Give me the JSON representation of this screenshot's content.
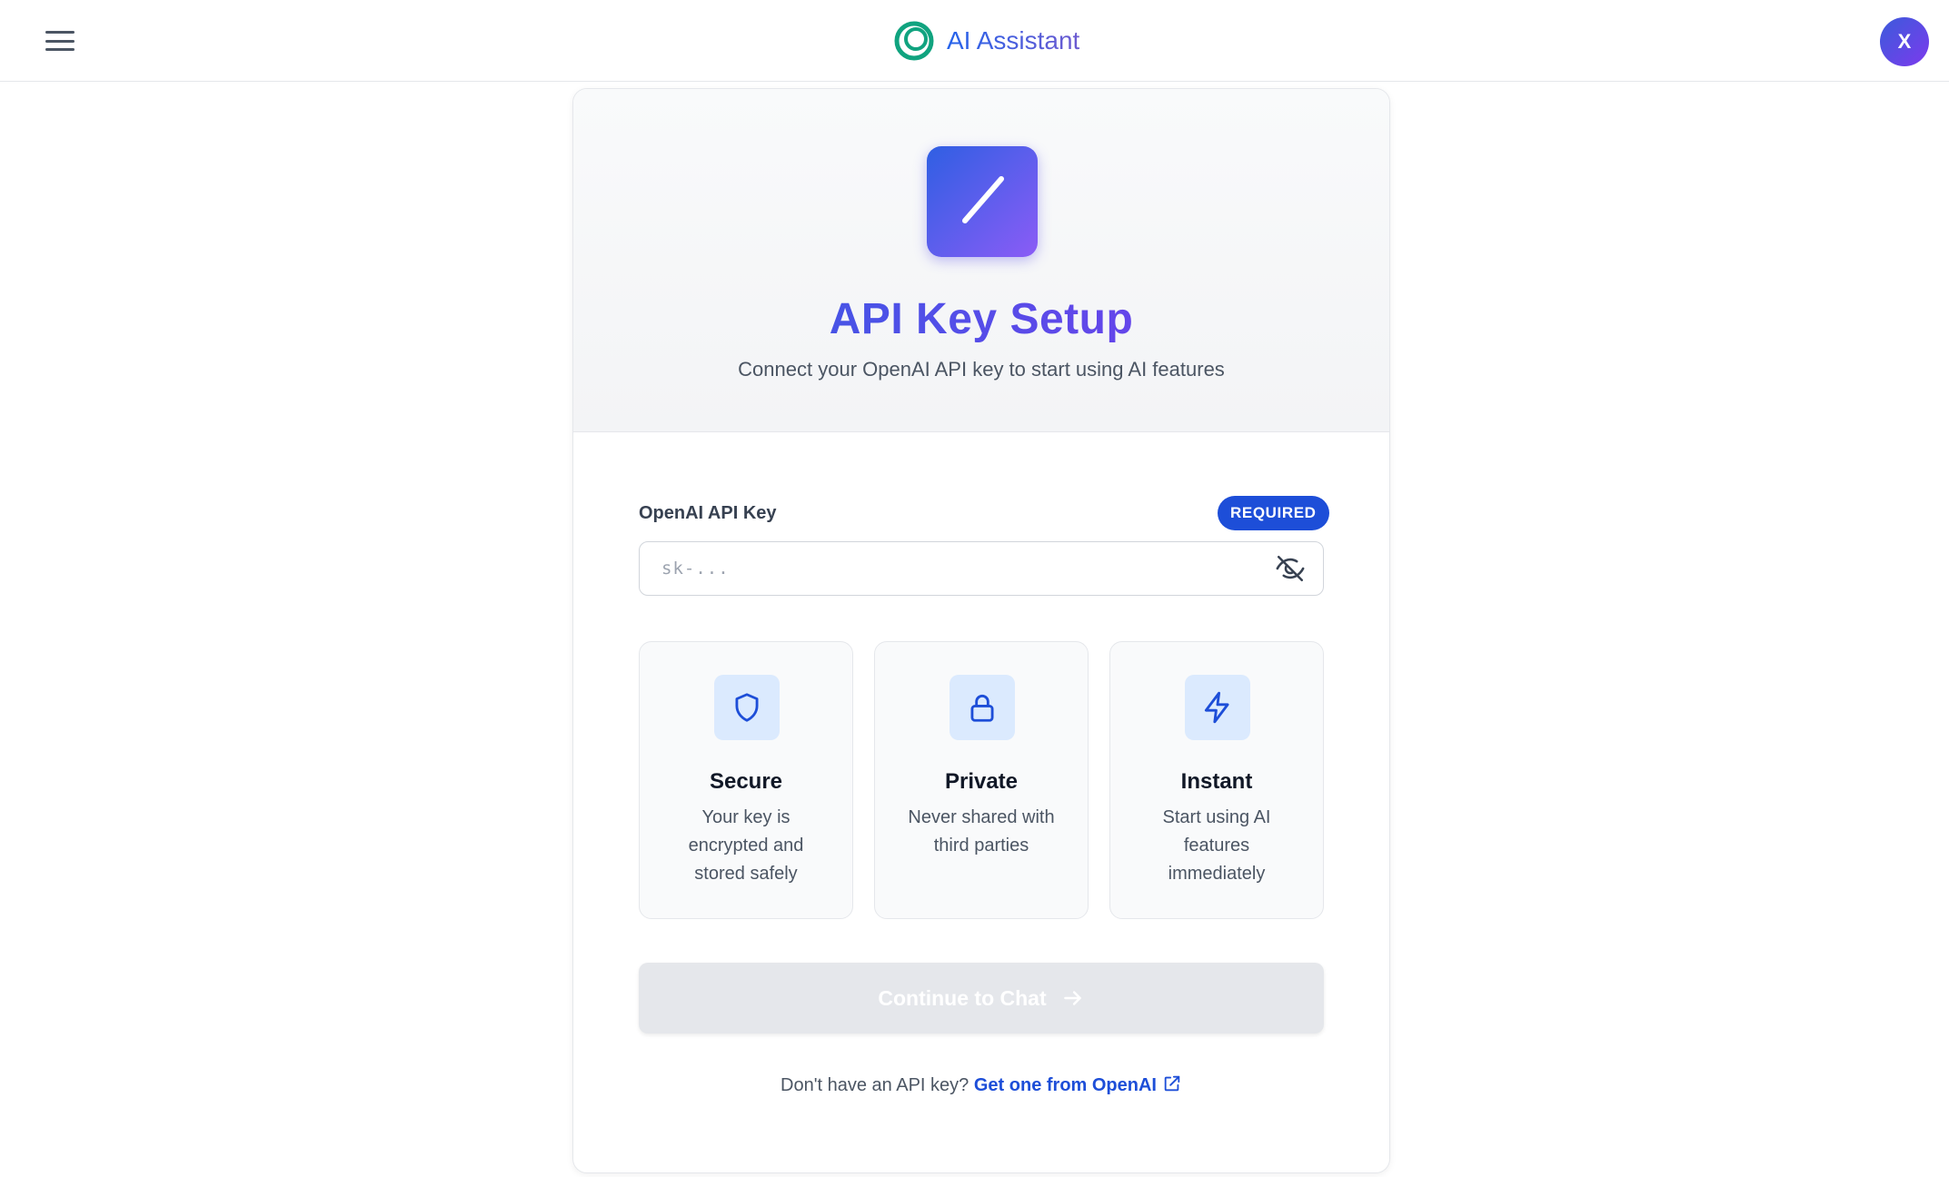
{
  "header": {
    "brand_title": "AI Assistant",
    "avatar_initial": "X"
  },
  "setup": {
    "title": "API Key Setup",
    "subtitle": "Connect your OpenAI API key to start using AI features",
    "field_label": "OpenAI API Key",
    "required_badge": "REQUIRED",
    "input_value": "",
    "input_placeholder": "sk-...",
    "features": [
      {
        "title": "Secure",
        "description": "Your key is encrypted and stored safely",
        "icon": "shield-icon"
      },
      {
        "title": "Private",
        "description": "Never shared with third parties",
        "icon": "lock-icon"
      },
      {
        "title": "Instant",
        "description": "Start using AI features immediately",
        "icon": "lightning-icon"
      }
    ],
    "continue_label": "Continue to Chat",
    "footer_prefix": "Don't have an API key?",
    "footer_link": "Get one from OpenAI"
  },
  "colors": {
    "accent": "#1d4ed8",
    "gradient_start": "#2f5fe3",
    "gradient_end": "#8b5cf6",
    "button_disabled": "#e5e7eb"
  }
}
